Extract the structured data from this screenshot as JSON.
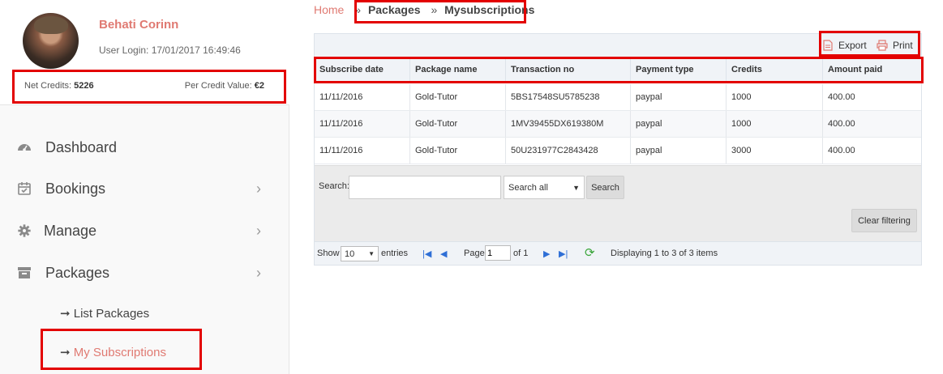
{
  "profile": {
    "name": "Behati Corinn",
    "login": "User Login: 17/01/2017 16:49:46",
    "net_credits_label": "Net Credits: ",
    "net_credits_value": "5226",
    "per_credit_label": "Per Credit Value: ",
    "per_credit_value": "€2"
  },
  "nav": [
    {
      "label": "Dashboard",
      "icon": "dashboard-icon"
    },
    {
      "label": "Bookings",
      "icon": "calendar-icon"
    },
    {
      "label": "Manage",
      "icon": "gear-icon"
    },
    {
      "label": "Packages",
      "icon": "archive-icon"
    }
  ],
  "subnav": [
    {
      "label": "List Packages",
      "arrow": "➞"
    },
    {
      "label": "My Subscriptions",
      "arrow": "➞"
    }
  ],
  "breadcrumb": {
    "home": "Home",
    "sep": "»",
    "packages": "Packages",
    "current": "Mysubscriptions"
  },
  "toolbar": {
    "export_label": "Export",
    "print_label": "Print"
  },
  "table": {
    "headers": [
      "Subscribe date",
      "Package name",
      "Transaction no",
      "Payment type",
      "Credits",
      "Amount paid"
    ],
    "rows": [
      [
        "11/11/2016",
        "Gold-Tutor",
        "5BS17548SU5785238",
        "paypal",
        "1000",
        "400.00"
      ],
      [
        "11/11/2016",
        "Gold-Tutor",
        "1MV39455DX619380M",
        "paypal",
        "1000",
        "400.00"
      ],
      [
        "11/11/2016",
        "Gold-Tutor",
        "50U231977C2843428",
        "paypal",
        "3000",
        "400.00"
      ]
    ]
  },
  "filter": {
    "search_label": "Search:",
    "search_value": "",
    "select_value": "Search all",
    "search_button": "Search",
    "clear_button": "Clear filtering"
  },
  "pager": {
    "show_label": "Show",
    "entries_value": "10",
    "entries_label": "entries",
    "page_label": "Page",
    "page_value": "1",
    "of_label": "of 1",
    "displaying": "Displaying 1 to 3 of 3 items"
  },
  "colors": {
    "accent": "#e07a72",
    "highlight": "#e30000",
    "link": "#2f6fd6"
  }
}
